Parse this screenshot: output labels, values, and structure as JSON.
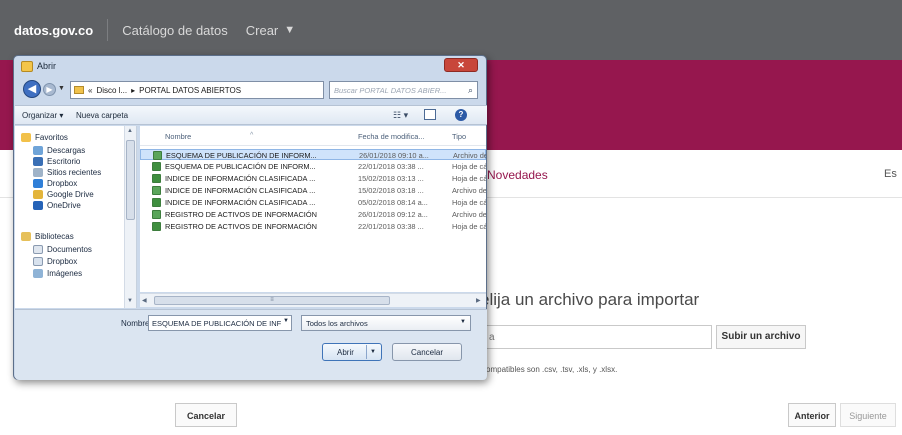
{
  "colors": {
    "topnav_bg": "#5f6164",
    "brand_banner": "#96174e",
    "dialog_frame": "#cbd9eb",
    "selection": "#cfe3fb"
  },
  "topnav": {
    "brand": "datos.gov.co",
    "catalog": "Catálogo de datos",
    "create": "Crear",
    "create_icon": "chevron-down-icon"
  },
  "tabs": {
    "novedades": "Novedades",
    "right_fragment": "Es"
  },
  "import": {
    "title": "elija un archivo para importar",
    "field_text": "a",
    "upload_button": "Subir un archivo",
    "note": "compatibles son .csv, .tsv, .xls, y .xlsx."
  },
  "footer": {
    "cancel": "Cancelar",
    "previous": "Anterior",
    "next": "Siguiente"
  },
  "dialog": {
    "title": "Abrir",
    "close_glyph": "✕",
    "address": {
      "prefix": "«",
      "part1": "Disco l...",
      "separator": "▸",
      "part2": "PORTAL DATOS ABIERTOS"
    },
    "search_placeholder": "Buscar PORTAL DATOS ABIER...",
    "toolbar": {
      "organize": "Organizar ▾",
      "new_folder": "Nueva carpeta"
    },
    "nav": {
      "favorites_header": "Favoritos",
      "favorites": [
        "Descargas",
        "Escritorio",
        "Sitios recientes",
        "Dropbox",
        "Google Drive",
        "OneDrive"
      ],
      "libraries_header": "Bibliotecas",
      "libraries": [
        "Documentos",
        "Dropbox",
        "Imágenes"
      ]
    },
    "columns": {
      "name": "Nombre",
      "date": "Fecha de modifica...",
      "type": "Tipo"
    },
    "files": [
      {
        "name": "ESQUEMA DE PUBLICACIÓN DE INFORM...",
        "date": "26/01/2018 09:10 a...",
        "type": "Archivo de",
        "selected": true,
        "icon": "csv-file-icon"
      },
      {
        "name": "ESQUEMA DE PUBLICACIÓN DE INFORM...",
        "date": "22/01/2018 03:38 ...",
        "type": "Hoja de cá",
        "selected": false,
        "icon": "xlsx-file-icon"
      },
      {
        "name": "INDICE DE INFORMACIÓN CLASIFICADA ...",
        "date": "15/02/2018 03:13 ...",
        "type": "Hoja de cá",
        "selected": false,
        "icon": "xlsx-file-icon"
      },
      {
        "name": "INDICE DE INFORMACIÓN CLASIFICADA ...",
        "date": "15/02/2018 03:18 ...",
        "type": "Archivo de",
        "selected": false,
        "icon": "csv-file-icon"
      },
      {
        "name": "INDICE DE INFORMACIÓN CLASIFICADA ...",
        "date": "05/02/2018 08:14 a...",
        "type": "Hoja de cá",
        "selected": false,
        "icon": "xlsx-file-icon"
      },
      {
        "name": "REGISTRO DE ACTIVOS DE INFORMACIÓN",
        "date": "26/01/2018 09:12 a...",
        "type": "Archivo de",
        "selected": false,
        "icon": "csv-file-icon"
      },
      {
        "name": "REGISTRO DE ACTIVOS DE INFORMACIÓN",
        "date": "22/01/2018 03:38 ...",
        "type": "Hoja de cá",
        "selected": false,
        "icon": "xlsx-file-icon"
      }
    ],
    "filename_label": "Nombre:",
    "filename_value": "ESQUEMA DE PUBLICACIÓN DE INF",
    "filter_value": "Todos los archivos",
    "open_button": "Abrir",
    "cancel_button": "Cancelar"
  }
}
